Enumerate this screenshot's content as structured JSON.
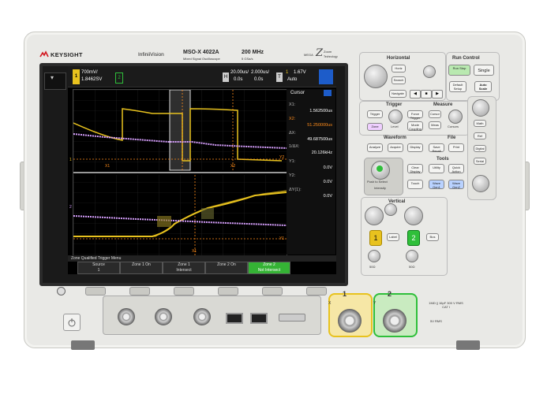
{
  "brand": {
    "name": "KEYSIGHT",
    "series": "InfiniiVision",
    "model": "MSO-X 4022A",
    "model_sub": "Mixed Signal Oscilloscope",
    "bandwidth": "200 MHz",
    "samplerate": "5 GSa/s",
    "mega_zoom": "MEGA",
    "mega_zoom_sub": "Zoom",
    "tech": "Technology"
  },
  "status": {
    "ch1_scale": "700mV/",
    "ch1_offset": "1.8462SV",
    "ch2_label": "2",
    "h_label": "H",
    "time_scale": "20.00us/",
    "delay": "2.000us/",
    "delay2": "0.0s",
    "delay3": "0.0s",
    "trig_label": "T",
    "trig_ch": "1",
    "trig_level": "1.67V",
    "trig_mode": "Auto"
  },
  "cursor_panel": {
    "title": "Cursor",
    "x1_label": "X1:",
    "x1_value": "1.562500us",
    "x2_label": "X2:",
    "x2_value": "51.250000us",
    "dx_label": "ΔX:",
    "dx_value": "49.687500us",
    "inv_dx_label": "1/ΔX:",
    "inv_dx_value": "20.126kHz",
    "y1_label": "Y1:",
    "y1_value": "0.0V",
    "y2_label": "Y2:",
    "y2_value": "0.0V",
    "dy_label": "ΔY(1):",
    "dy_value": "0.0V"
  },
  "markers": {
    "x1": "X1",
    "x2": "X2",
    "y2": "Y2",
    "x1b": "X1",
    "x2b": "X2",
    "y1b": "Y1",
    "ch1": "1",
    "ch2": "2"
  },
  "menu": {
    "title": "Zone Qualified Trigger Menu",
    "softkeys": [
      {
        "line1": "Source",
        "line2": "1"
      },
      {
        "line1": "Zone 1 On",
        "line2": ""
      },
      {
        "line1": "Zone 1",
        "line2": "Intersect"
      },
      {
        "line1": "Zone 2 On",
        "line2": ""
      },
      {
        "line1": "Zone 2",
        "line2": "Not Intersect"
      }
    ]
  },
  "front_panel": {
    "horizontal": "Horizontal",
    "run_control": "Run Control",
    "run_stop": "Run Stop",
    "single": "Single",
    "horiz": "Horiz",
    "search": "Search",
    "navigate": "Navigate",
    "default_setup": "Default Setup",
    "auto_scale": "Auto Scale",
    "trigger": "Trigger",
    "measure": "Measure",
    "trigger_key": "Trigger",
    "force_trigger": "Force Trigger",
    "cursor": "Cursor",
    "meas": "Meas",
    "zone": "Zone",
    "level": "Level",
    "mode_coupling": "Mode Coupling",
    "cursors": "Cursors",
    "waveform": "Waveform",
    "file": "File",
    "analyze": "Analyze",
    "acquire": "Acquire",
    "display": "Display",
    "save_recall": "Save Recall",
    "print": "Print",
    "tools": "Tools",
    "push_select": "Push to Select",
    "intensity": "Intensity",
    "clear_display": "Clear Display",
    "utility": "Utility",
    "quick_action": "Quick Action",
    "touch": "Touch",
    "wave_gen1": "Wave Gen1",
    "wave_gen2": "Wave Gen2",
    "vertical": "Vertical",
    "ch1": "1",
    "ch2": "2",
    "label": "Label",
    "math": "Math",
    "ref": "Ref",
    "bus": "Bus",
    "digital": "Digital",
    "serial": "Serial",
    "scale_50": "50Ω",
    "scale_50b": "50Ω",
    "input_x": "X",
    "input_y": "Y",
    "in1": "1",
    "in2": "2",
    "input_spec": "1MΩ || 16pF 300 V RMS CAT I",
    "caution": "5V RMS"
  },
  "colors": {
    "ch1": "#e8c21e",
    "ch2": "#2fbf3a",
    "digital": "#d8a0ff",
    "cursor": "#ff8c1a",
    "softkey_active": "#35b335"
  }
}
